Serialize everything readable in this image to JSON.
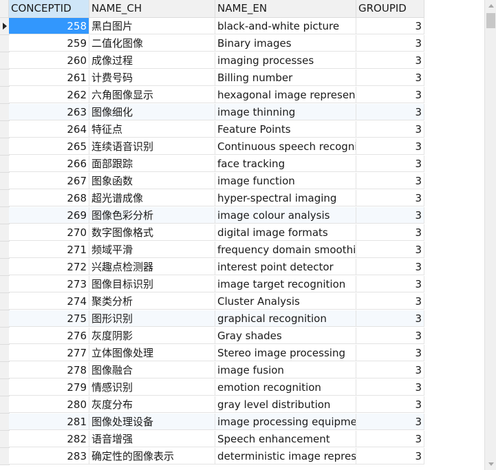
{
  "table": {
    "columns": [
      "CONCEPTID",
      "NAME_CH",
      "NAME_EN",
      "GROUPID"
    ],
    "rows": [
      [
        "258",
        "黑白图片",
        "black-and-white picture",
        "3"
      ],
      [
        "259",
        "二值化图像",
        "Binary images",
        "3"
      ],
      [
        "260",
        "成像过程",
        "imaging processes",
        "3"
      ],
      [
        "261",
        "计费号码",
        "Billing number",
        "3"
      ],
      [
        "262",
        "六角图像显示",
        "hexagonal image represent",
        "3"
      ],
      [
        "263",
        "图像细化",
        "image thinning",
        "3"
      ],
      [
        "264",
        "特征点",
        "Feature Points",
        "3"
      ],
      [
        "265",
        "连续语音识别",
        "Continuous speech recogni",
        "3"
      ],
      [
        "266",
        "面部跟踪",
        "face tracking",
        "3"
      ],
      [
        "267",
        "图象函数",
        "image function",
        "3"
      ],
      [
        "268",
        "超光谱成像",
        "hyper-spectral imaging",
        "3"
      ],
      [
        "269",
        "图像色彩分析",
        "image colour analysis",
        "3"
      ],
      [
        "270",
        "数字图像格式",
        "digital image formats",
        "3"
      ],
      [
        "271",
        "频域平滑",
        "frequency domain smoothin",
        "3"
      ],
      [
        "272",
        "兴趣点检测器",
        "interest point detector",
        "3"
      ],
      [
        "273",
        "图像目标识别",
        "image target recognition",
        "3"
      ],
      [
        "274",
        "聚类分析",
        "Cluster Analysis",
        "3"
      ],
      [
        "275",
        "图形识别",
        "graphical recognition",
        "3"
      ],
      [
        "276",
        "灰度阴影",
        "Gray shades",
        "3"
      ],
      [
        "277",
        "立体图像处理",
        "Stereo image processing",
        "3"
      ],
      [
        "278",
        "图像融合",
        "image fusion",
        "3"
      ],
      [
        "279",
        "情感识别",
        "emotion recognition",
        "3"
      ],
      [
        "280",
        "灰度分布",
        "gray level distribution",
        "3"
      ],
      [
        "281",
        "图像处理设备",
        "image processing equipmen",
        "3"
      ],
      [
        "282",
        "语音增强",
        "Speech enhancement",
        "3"
      ],
      [
        "283",
        "确定性的图像表示",
        "deterministic image represe",
        "3"
      ]
    ],
    "active_row_index": 0,
    "alt_row_indices": [
      5,
      11,
      17,
      23
    ]
  },
  "icons": {
    "row_indicator": "current-row-arrow-icon",
    "scroll_up": "chevron-up-icon",
    "scroll_down": "chevron-down-icon"
  },
  "colors": {
    "selection": "#3297fd",
    "header_bg": "#f1f1f1",
    "alt_row_bg": "#f5f9fd"
  }
}
